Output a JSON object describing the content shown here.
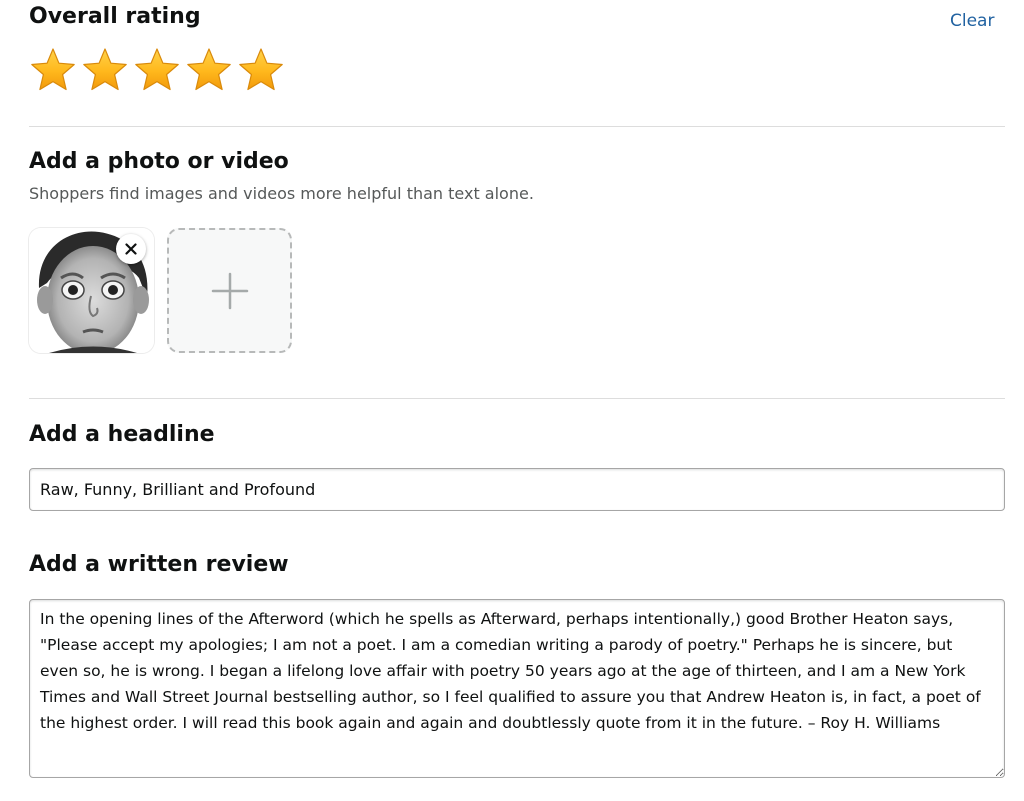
{
  "rating": {
    "title": "Overall rating",
    "clear_label": "Clear",
    "value": 5,
    "max": 5,
    "star_color": "#ffb81c"
  },
  "media": {
    "title": "Add a photo or video",
    "subtitle": "Shoppers find images and videos more helpful than text alone.",
    "remove_icon": "close-icon",
    "add_icon": "plus-icon"
  },
  "headline": {
    "title": "Add a headline",
    "value": "Raw, Funny, Brilliant and Profound"
  },
  "review": {
    "title": "Add a written review",
    "value": "In the opening lines of the Afterword (which he spells as Afterward, perhaps intentionally,) good Brother Heaton says, \"Please accept my apologies; I am not a poet. I am a comedian writing a parody of poetry.\" Perhaps he is sincere, but even so, he is wrong. I began a lifelong love affair with poetry 50 years ago at the age of thirteen, and I am a New York Times and Wall Street Journal bestselling author, so I feel qualified to assure you that Andrew Heaton is, in fact, a poet of the highest order. I will read this book again and again and doubtlessly quote from it in the future. – Roy H. Williams"
  },
  "colors": {
    "link": "#2162a1",
    "text": "#0f1111",
    "muted": "#565959",
    "divider": "#dddddd"
  }
}
